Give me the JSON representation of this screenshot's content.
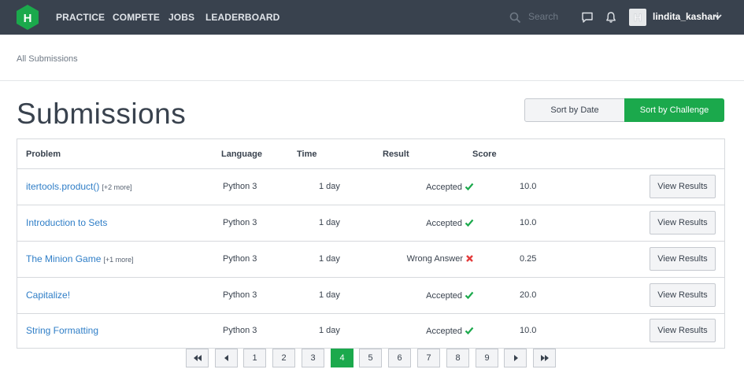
{
  "nav": {
    "logo_letter": "H",
    "links": [
      "PRACTICE",
      "COMPETE",
      "JOBS",
      "LEADERBOARD"
    ],
    "search_placeholder": "Search",
    "username": "lindita_kashari",
    "avatar_letter": "H"
  },
  "breadcrumb": "All Submissions",
  "title": "Submissions",
  "sort": {
    "by_date": "Sort by Date",
    "by_challenge": "Sort by Challenge",
    "active": "by_challenge"
  },
  "table": {
    "headers": {
      "problem": "Problem",
      "language": "Language",
      "time": "Time",
      "result": "Result",
      "score": "Score"
    },
    "view_label": "View Results",
    "rows": [
      {
        "problem": "itertools.product()",
        "more": "[+2 more]",
        "language": "Python 3",
        "time": "1 day",
        "result": "Accepted",
        "status": "ok",
        "score": "10.0"
      },
      {
        "problem": "Introduction to Sets",
        "more": "",
        "language": "Python 3",
        "time": "1 day",
        "result": "Accepted",
        "status": "ok",
        "score": "10.0"
      },
      {
        "problem": "The Minion Game",
        "more": "[+1 more]",
        "language": "Python 3",
        "time": "1 day",
        "result": "Wrong Answer",
        "status": "fail",
        "score": "0.25"
      },
      {
        "problem": "Capitalize!",
        "more": "",
        "language": "Python 3",
        "time": "1 day",
        "result": "Accepted",
        "status": "ok",
        "score": "20.0"
      },
      {
        "problem": "String Formatting",
        "more": "",
        "language": "Python 3",
        "time": "1 day",
        "result": "Accepted",
        "status": "ok",
        "score": "10.0"
      }
    ]
  },
  "pagination": {
    "pages": [
      "1",
      "2",
      "3",
      "4",
      "5",
      "6",
      "7",
      "8",
      "9"
    ],
    "current": "4"
  },
  "colors": {
    "nav_bg": "#39424e",
    "accent": "#1ba94c",
    "link": "#2f7ec7",
    "fail": "#e33b3b"
  }
}
